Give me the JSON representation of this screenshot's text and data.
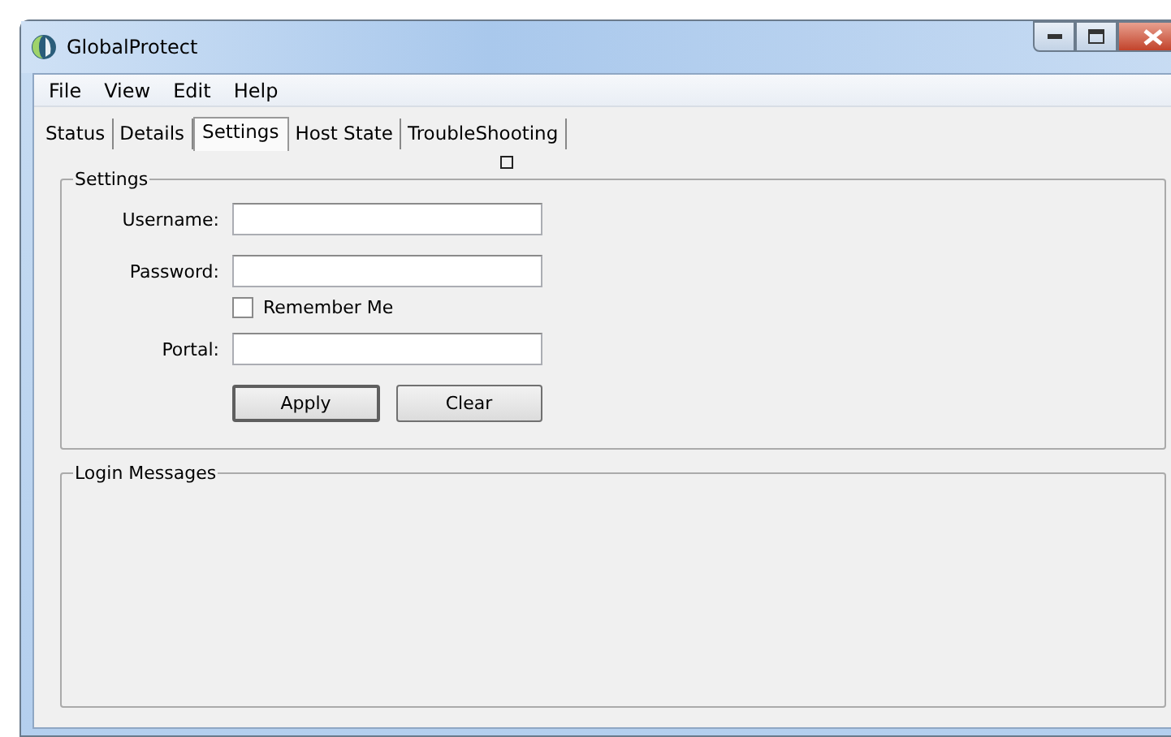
{
  "window": {
    "title": "GlobalProtect"
  },
  "menu": [
    "File",
    "View",
    "Edit",
    "Help"
  ],
  "tabs": [
    {
      "label": "Status",
      "selected": false
    },
    {
      "label": "Details",
      "selected": false
    },
    {
      "label": "Settings",
      "selected": true
    },
    {
      "label": "Host State",
      "selected": false
    },
    {
      "label": "TroubleShooting",
      "selected": false
    }
  ],
  "settings": {
    "title": "Settings",
    "fields": [
      {
        "kind": "text",
        "label": "Username:"
      },
      {
        "kind": "text",
        "label": "Password:"
      },
      {
        "kind": "checkbox",
        "label": "Remember Me",
        "checked": false
      },
      {
        "kind": "text",
        "label": "Portal:"
      }
    ],
    "buttons": [
      {
        "label": "Apply",
        "default": true
      },
      {
        "label": "Clear",
        "default": false
      }
    ]
  },
  "login_messages": {
    "title": "Login Messages"
  }
}
